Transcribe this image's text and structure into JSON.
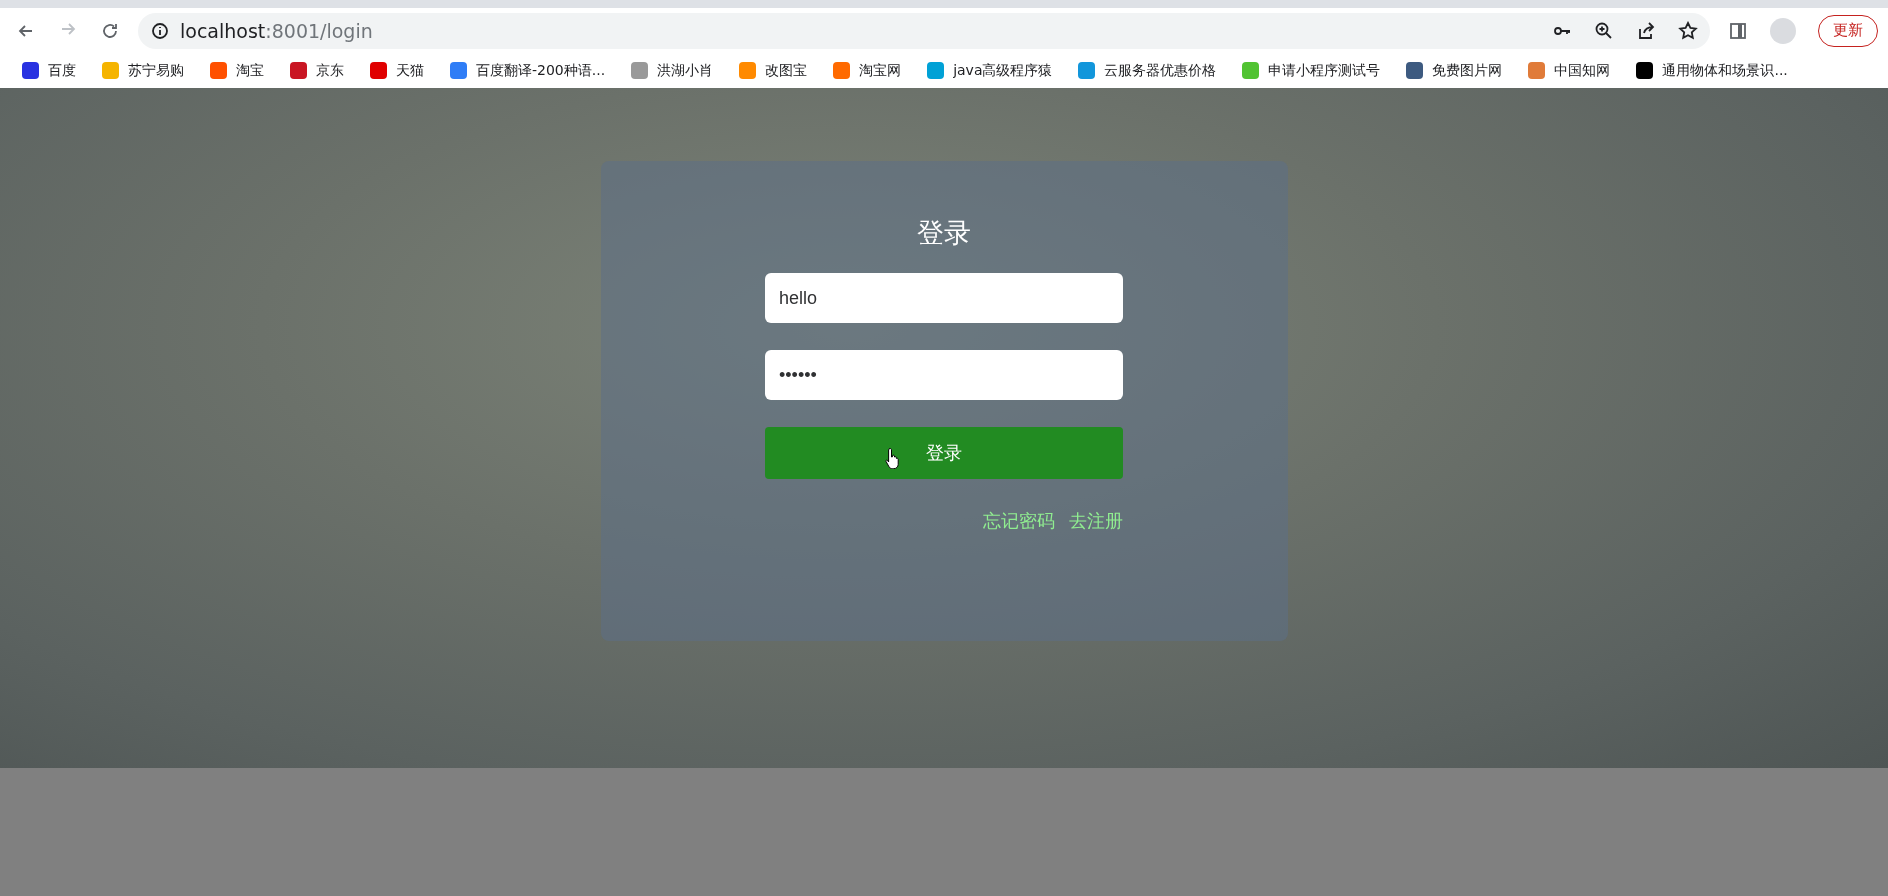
{
  "browser": {
    "url_host": "localhost",
    "url_path": ":8001/login",
    "update_button": "更新"
  },
  "bookmarks": [
    {
      "label": "百度",
      "color": "#2932e1"
    },
    {
      "label": "苏宁易购",
      "color": "#f5b400"
    },
    {
      "label": "淘宝",
      "color": "#ff5000"
    },
    {
      "label": "京东",
      "color": "#c91623"
    },
    {
      "label": "天猫",
      "color": "#e00000"
    },
    {
      "label": "百度翻译-200种语...",
      "color": "#2f7df6"
    },
    {
      "label": "洪湖小肖",
      "color": "#999999"
    },
    {
      "label": "改图宝",
      "color": "#ff8a00"
    },
    {
      "label": "淘宝网",
      "color": "#ff6a00"
    },
    {
      "label": "java高级程序猿",
      "color": "#00a1d6"
    },
    {
      "label": "云服务器优惠价格",
      "color": "#1296db"
    },
    {
      "label": "申请小程序测试号",
      "color": "#51c332"
    },
    {
      "label": "免费图片网",
      "color": "#3d5a80"
    },
    {
      "label": "中国知网",
      "color": "#e07b39"
    },
    {
      "label": "通用物体和场景识...",
      "color": "#000000"
    }
  ],
  "login": {
    "title": "登录",
    "username": {
      "value": "hello"
    },
    "password": {
      "value": "••••••"
    },
    "submit": "登录",
    "links": [
      "忘记密码",
      "去注册"
    ]
  }
}
